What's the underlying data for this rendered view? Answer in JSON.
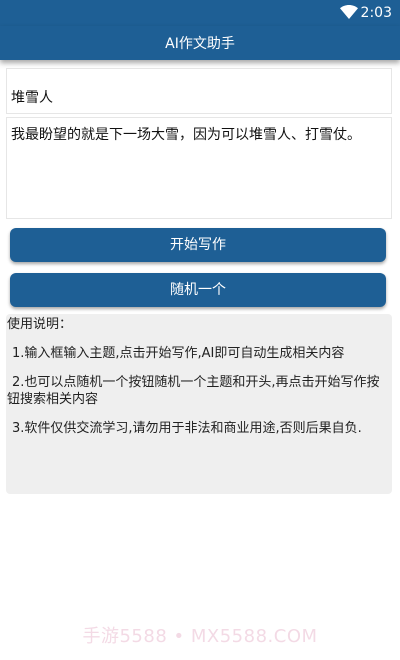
{
  "status_bar": {
    "time": "2:03",
    "wifi_icon": "wifi-icon",
    "color": "#1e5f95"
  },
  "app_bar": {
    "title": "AI作文助手",
    "color": "#1e5f95"
  },
  "topic_input": {
    "value": "堆雪人"
  },
  "opening_input": {
    "value": "我最盼望的就是下一场大雪，因为可以堆雪人、打雪仗。"
  },
  "buttons": {
    "start_label": "开始写作",
    "random_label": "随机一个"
  },
  "instructions": {
    "heading": "使用说明：",
    "lines": [
      "1.输入框输入主题,点击开始写作,AI即可自动生成相关内容",
      "2.也可以点随机一个按钮随机一个主题和开头,再点击开始写作按钮搜索相关内容",
      "3.软件仅供交流学习,请勿用于非法和商业用途,否则后果自负."
    ]
  },
  "watermark": "手游5588 • MX5588.COM"
}
